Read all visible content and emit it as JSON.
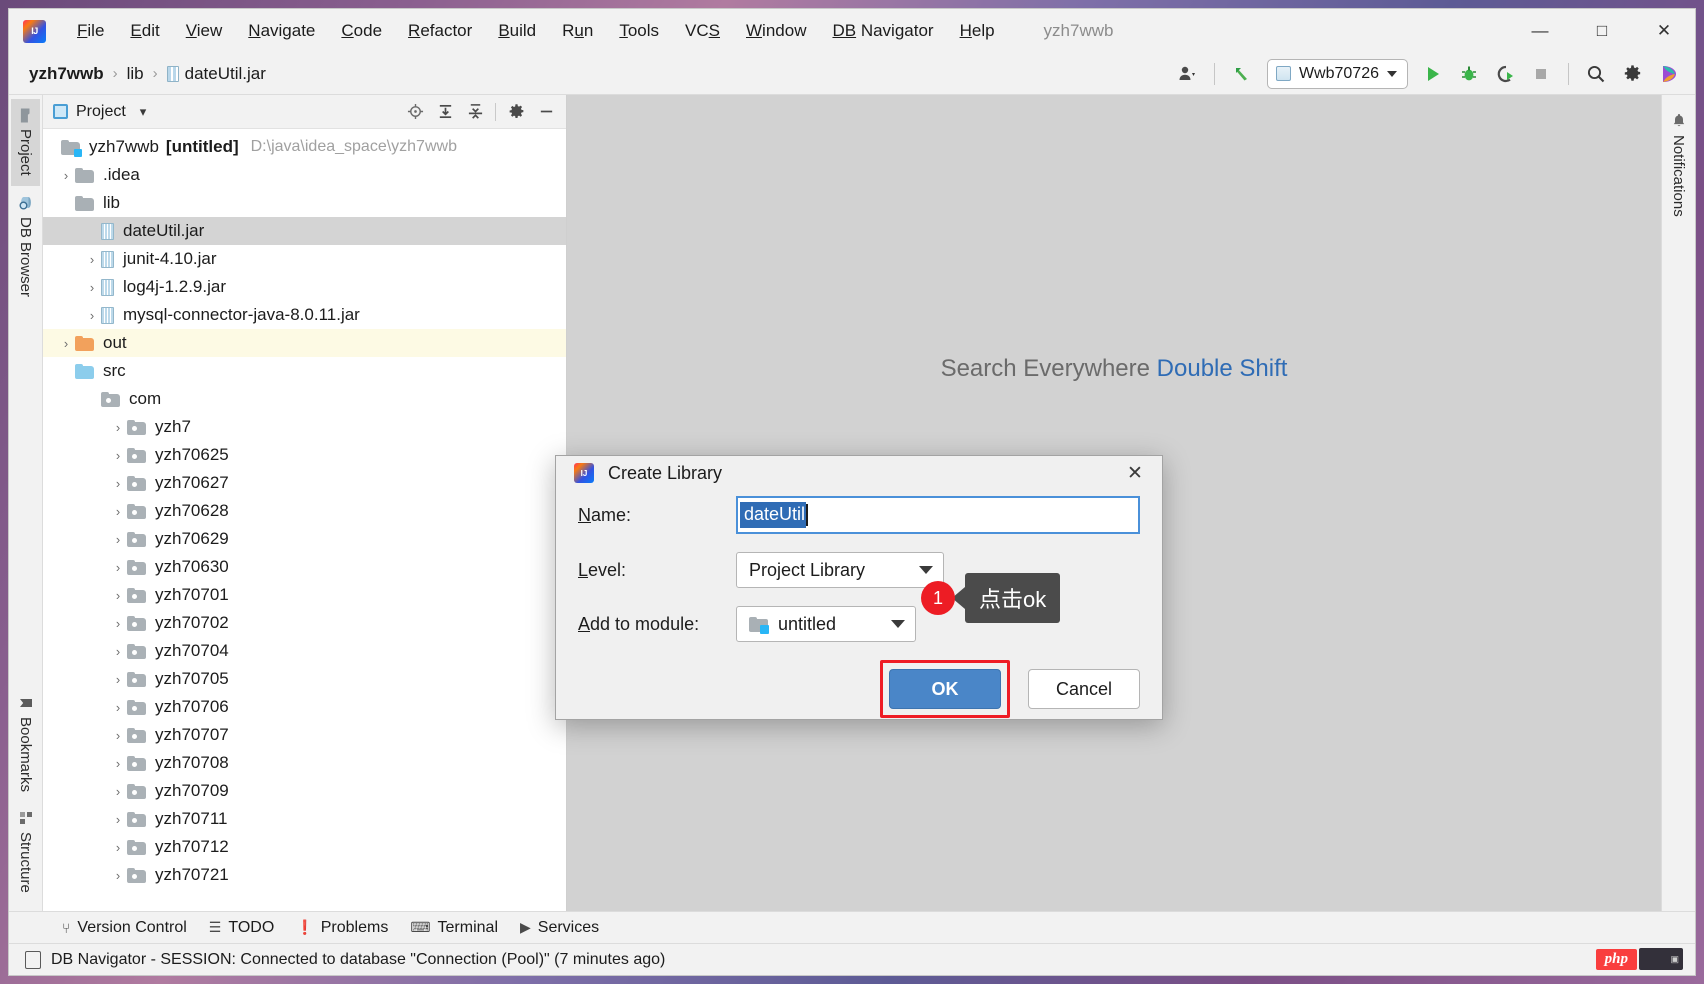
{
  "window": {
    "title": "yzh7wwb",
    "minimize_label": "—",
    "maximize_label": "□",
    "close_label": "✕"
  },
  "menu": {
    "items": [
      {
        "pre": "",
        "mn": "F",
        "post": "ile"
      },
      {
        "pre": "",
        "mn": "E",
        "post": "dit"
      },
      {
        "pre": "",
        "mn": "V",
        "post": "iew"
      },
      {
        "pre": "",
        "mn": "N",
        "post": "avigate"
      },
      {
        "pre": "",
        "mn": "C",
        "post": "ode"
      },
      {
        "pre": "",
        "mn": "R",
        "post": "efactor"
      },
      {
        "pre": "",
        "mn": "B",
        "post": "uild"
      },
      {
        "pre": "R",
        "mn": "u",
        "post": "n"
      },
      {
        "pre": "",
        "mn": "T",
        "post": "ools"
      },
      {
        "pre": "VC",
        "mn": "S",
        "post": ""
      },
      {
        "pre": "",
        "mn": "W",
        "post": "indow"
      },
      {
        "pre": "",
        "mn": "DB",
        "post": " Navigator"
      },
      {
        "pre": "",
        "mn": "H",
        "post": "elp"
      }
    ]
  },
  "navbar": {
    "breadcrumb": [
      {
        "label": "yzh7wwb",
        "bold": true,
        "icon": ""
      },
      {
        "label": "lib",
        "bold": false,
        "icon": ""
      },
      {
        "label": "dateUtil.jar",
        "bold": false,
        "icon": "jar-icon"
      }
    ],
    "separator": "›",
    "run_config": "Wwb70726",
    "icons": {
      "account": "account-icon",
      "update": "update-project-icon",
      "run": "run-icon",
      "debug": "debug-icon",
      "run_coverage": "run-with-coverage-icon",
      "stop": "stop-icon",
      "search": "search-icon",
      "settings": "settings-icon",
      "ai": "ai-assistant-icon"
    }
  },
  "left_strip": {
    "tabs": [
      {
        "label": "Project",
        "icon": "project-folder-icon",
        "active": true
      },
      {
        "label": "DB Browser",
        "icon": "db-browser-icon",
        "active": false
      }
    ],
    "bottom_tabs": [
      {
        "label": "Bookmarks",
        "icon": "bookmark-icon",
        "active": false
      },
      {
        "label": "Structure",
        "icon": "structure-icon",
        "active": false
      }
    ]
  },
  "right_strip": {
    "tabs": [
      {
        "label": "Notifications",
        "icon": "bell-icon",
        "active": false
      }
    ]
  },
  "project_panel": {
    "title": "Project",
    "title_caret": "▾",
    "actions": [
      {
        "name": "select-opened-file-icon",
        "glyph": "⊕"
      },
      {
        "name": "expand-all-icon",
        "glyph": "↧"
      },
      {
        "name": "collapse-all-icon",
        "glyph": "↥"
      },
      {
        "name": "options-gear-icon",
        "glyph": "⚙"
      },
      {
        "name": "hide-panel-icon",
        "glyph": "—"
      }
    ],
    "tree": [
      {
        "label": "yzh7wwb",
        "suffix": "[untitled]",
        "path": "D:\\java\\idea_space\\yzh7wwb",
        "indent": 0,
        "arrow": "ⱟ",
        "icon": "module-folder",
        "selected": false,
        "highlight": false
      },
      {
        "label": ".idea",
        "indent": 1,
        "arrow": "›",
        "icon": "folder-grey",
        "selected": false,
        "highlight": false
      },
      {
        "label": "lib",
        "indent": 1,
        "arrow": "ⱟ",
        "icon": "folder-grey",
        "selected": false,
        "highlight": false
      },
      {
        "label": "dateUtil.jar",
        "indent": 2,
        "arrow": "",
        "icon": "jar",
        "selected": true,
        "highlight": false
      },
      {
        "label": "junit-4.10.jar",
        "indent": 2,
        "arrow": "›",
        "icon": "jar",
        "selected": false,
        "highlight": false
      },
      {
        "label": "log4j-1.2.9.jar",
        "indent": 2,
        "arrow": "›",
        "icon": "jar",
        "selected": false,
        "highlight": false
      },
      {
        "label": "mysql-connector-java-8.0.11.jar",
        "indent": 2,
        "arrow": "›",
        "icon": "jar",
        "selected": false,
        "highlight": false
      },
      {
        "label": "out",
        "indent": 1,
        "arrow": "›",
        "icon": "folder-orange",
        "selected": false,
        "highlight": true
      },
      {
        "label": "src",
        "indent": 1,
        "arrow": "ⱟ",
        "icon": "folder-blue",
        "selected": false,
        "highlight": false
      },
      {
        "label": "com",
        "indent": 2,
        "arrow": "ⱟ",
        "icon": "package",
        "selected": false,
        "highlight": false
      },
      {
        "label": "yzh7",
        "indent": 3,
        "arrow": "›",
        "icon": "package",
        "selected": false,
        "highlight": false
      },
      {
        "label": "yzh70625",
        "indent": 3,
        "arrow": "›",
        "icon": "package",
        "selected": false,
        "highlight": false
      },
      {
        "label": "yzh70627",
        "indent": 3,
        "arrow": "›",
        "icon": "package",
        "selected": false,
        "highlight": false
      },
      {
        "label": "yzh70628",
        "indent": 3,
        "arrow": "›",
        "icon": "package",
        "selected": false,
        "highlight": false
      },
      {
        "label": "yzh70629",
        "indent": 3,
        "arrow": "›",
        "icon": "package",
        "selected": false,
        "highlight": false
      },
      {
        "label": "yzh70630",
        "indent": 3,
        "arrow": "›",
        "icon": "package",
        "selected": false,
        "highlight": false
      },
      {
        "label": "yzh70701",
        "indent": 3,
        "arrow": "›",
        "icon": "package",
        "selected": false,
        "highlight": false
      },
      {
        "label": "yzh70702",
        "indent": 3,
        "arrow": "›",
        "icon": "package",
        "selected": false,
        "highlight": false
      },
      {
        "label": "yzh70704",
        "indent": 3,
        "arrow": "›",
        "icon": "package",
        "selected": false,
        "highlight": false
      },
      {
        "label": "yzh70705",
        "indent": 3,
        "arrow": "›",
        "icon": "package",
        "selected": false,
        "highlight": false
      },
      {
        "label": "yzh70706",
        "indent": 3,
        "arrow": "›",
        "icon": "package",
        "selected": false,
        "highlight": false
      },
      {
        "label": "yzh70707",
        "indent": 3,
        "arrow": "›",
        "icon": "package",
        "selected": false,
        "highlight": false
      },
      {
        "label": "yzh70708",
        "indent": 3,
        "arrow": "›",
        "icon": "package",
        "selected": false,
        "highlight": false
      },
      {
        "label": "yzh70709",
        "indent": 3,
        "arrow": "›",
        "icon": "package",
        "selected": false,
        "highlight": false
      },
      {
        "label": "yzh70711",
        "indent": 3,
        "arrow": "›",
        "icon": "package",
        "selected": false,
        "highlight": false
      },
      {
        "label": "yzh70712",
        "indent": 3,
        "arrow": "›",
        "icon": "package",
        "selected": false,
        "highlight": false
      },
      {
        "label": "yzh70721",
        "indent": 3,
        "arrow": "›",
        "icon": "package",
        "selected": false,
        "highlight": false
      }
    ]
  },
  "editor": {
    "watermark_text": "Search Everywhere",
    "watermark_key": "Double Shift"
  },
  "dialog": {
    "title": "Create Library",
    "close_glyph": "✕",
    "name_label_pre": "",
    "name_label_mn": "N",
    "name_label_post": "ame:",
    "name_value": "dateUtil",
    "level_label_mn": "L",
    "level_label_post": "evel:",
    "level_value": "Project Library",
    "module_label_mn": "A",
    "module_label_post": "dd to module:",
    "module_value": "untitled",
    "ok_label": "OK",
    "cancel_label": "Cancel"
  },
  "callout": {
    "number": "1",
    "text": "点击ok"
  },
  "bottom_tools": [
    {
      "label": "Version Control",
      "icon": "branch-icon",
      "glyph": "⑂"
    },
    {
      "label": "TODO",
      "icon": "todo-list-icon",
      "glyph": "☰"
    },
    {
      "label": "Problems",
      "icon": "problems-icon",
      "glyph": "❗"
    },
    {
      "label": "Terminal",
      "icon": "terminal-icon",
      "glyph": "⌨"
    },
    {
      "label": "Services",
      "icon": "services-icon",
      "glyph": "▶"
    }
  ],
  "statusbar": {
    "message": "DB Navigator  - SESSION: Connected to database \"Connection (Pool)\" (7 minutes ago)",
    "php_badge": "php"
  },
  "colors": {
    "accent_blue": "#4a86c8",
    "highlight_red": "#ee1c25",
    "selection_blue": "#2f6cb5",
    "tree_selected": "#d4d4d4",
    "tree_highlight": "#fdfae4",
    "editor_bg": "#d2d2d2"
  }
}
